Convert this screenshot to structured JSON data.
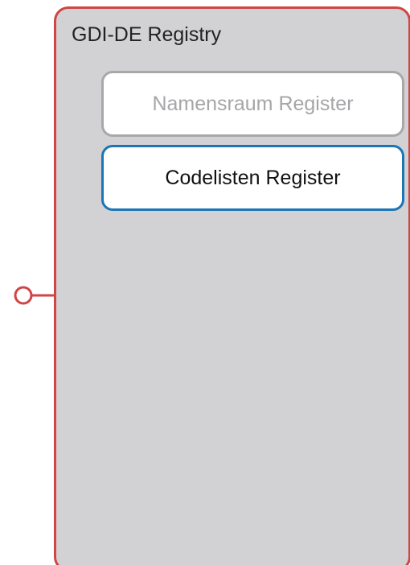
{
  "registry": {
    "title": "GDI-DE Registry",
    "border_color": "#d04545",
    "background_color": "#d2d2d4"
  },
  "components": [
    {
      "label": "Namensraum Register",
      "state": "inactive",
      "border_color": "#a8a8ab"
    },
    {
      "label": "Codelisten Register",
      "state": "active",
      "border_color": "#1b75b6"
    }
  ],
  "interface": {
    "icon": "lollipop-interface-icon",
    "color": "#d04545"
  }
}
